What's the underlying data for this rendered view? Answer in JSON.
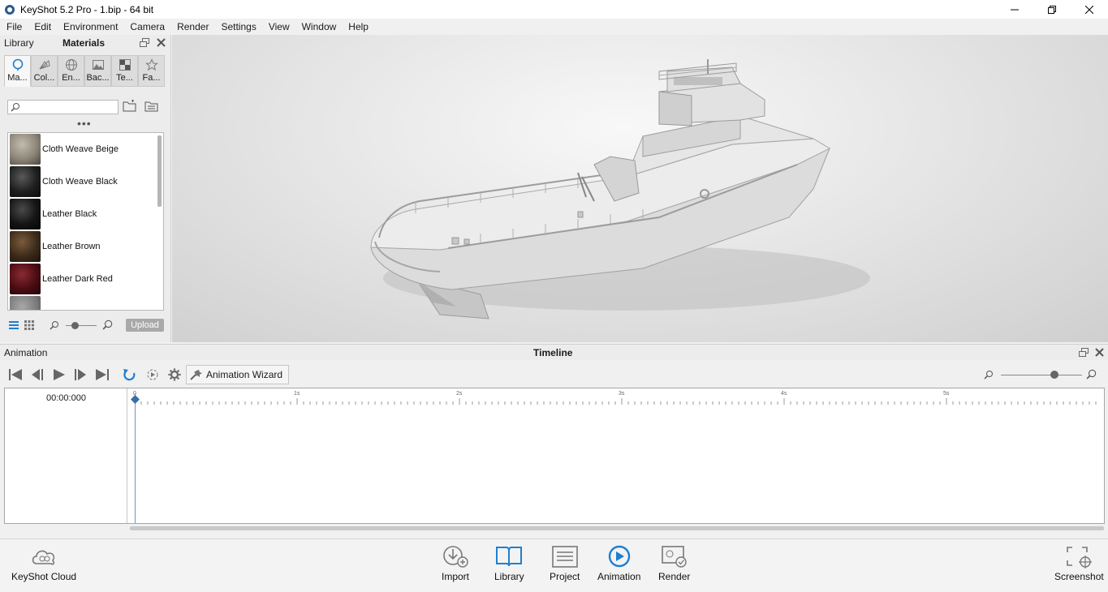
{
  "window": {
    "title": "KeyShot 5.2 Pro  - 1.bip  - 64 bit"
  },
  "menu": [
    "File",
    "Edit",
    "Environment",
    "Camera",
    "Render",
    "Settings",
    "View",
    "Window",
    "Help"
  ],
  "library": {
    "header_library": "Library",
    "header_materials": "Materials",
    "tabs": [
      {
        "label": "Ma...",
        "icon": "materials-icon"
      },
      {
        "label": "Col...",
        "icon": "colors-icon"
      },
      {
        "label": "En...",
        "icon": "environments-icon"
      },
      {
        "label": "Bac...",
        "icon": "backplates-icon"
      },
      {
        "label": "Te...",
        "icon": "textures-icon"
      },
      {
        "label": "Fa...",
        "icon": "favorites-icon"
      }
    ],
    "search_placeholder": "",
    "materials": [
      {
        "name": "Cloth Weave Beige",
        "color": "#8c8578"
      },
      {
        "name": "Cloth Weave Black",
        "color": "#1e1e1e"
      },
      {
        "name": "Leather Black",
        "color": "#141414"
      },
      {
        "name": "Leather Brown",
        "color": "#3b2a1a"
      },
      {
        "name": "Leather Dark Red",
        "color": "#4a0c12"
      }
    ],
    "upload_label": "Upload"
  },
  "animation": {
    "panel_label": "Animation",
    "timeline_label": "Timeline",
    "wizard_label": "Animation Wizard",
    "time_readout": "00:00:000",
    "ruler_labels": [
      "0",
      "1s",
      "2s",
      "3s",
      "4s",
      "5s"
    ]
  },
  "bottombar": {
    "cloud_label": "KeyShot Cloud",
    "import_label": "Import",
    "library_label": "Library",
    "project_label": "Project",
    "animation_label": "Animation",
    "render_label": "Render",
    "screenshot_label": "Screenshot"
  },
  "colors": {
    "accent": "#1e7fd1",
    "panel": "#ececec"
  }
}
